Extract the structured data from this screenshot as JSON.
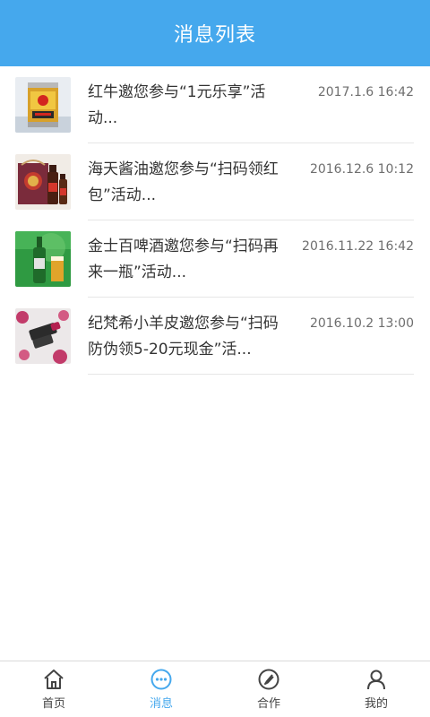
{
  "header": {
    "title": "消息列表"
  },
  "messages": [
    {
      "title": "红牛邀您参与“1元乐享”活动...",
      "time": "2017.1.6 16:42",
      "thumb_icon": "red-bull-can-image"
    },
    {
      "title": "海天酱油邀您参与“扫码领红包”活动...",
      "time": "2016.12.6 10:12",
      "thumb_icon": "soy-sauce-image"
    },
    {
      "title": "金士百啤酒邀您参与“扫码再来一瓶”活动...",
      "time": "2016.11.22 16:42",
      "thumb_icon": "beer-bottle-image"
    },
    {
      "title": "纪梵希小羊皮邀您参与“扫码防伪领5-20元现金”活...",
      "time": "2016.10.2 13:00",
      "thumb_icon": "lipstick-image"
    }
  ],
  "tabbar": {
    "items": [
      {
        "label": "首页",
        "icon": "home-icon",
        "active": false
      },
      {
        "label": "消息",
        "icon": "message-icon",
        "active": true
      },
      {
        "label": "合作",
        "icon": "cooperation-icon",
        "active": false
      },
      {
        "label": "我的",
        "icon": "user-icon",
        "active": false
      }
    ]
  },
  "colors": {
    "accent": "#45a8ed",
    "text": "#333333",
    "muted": "#6e6e6e"
  }
}
